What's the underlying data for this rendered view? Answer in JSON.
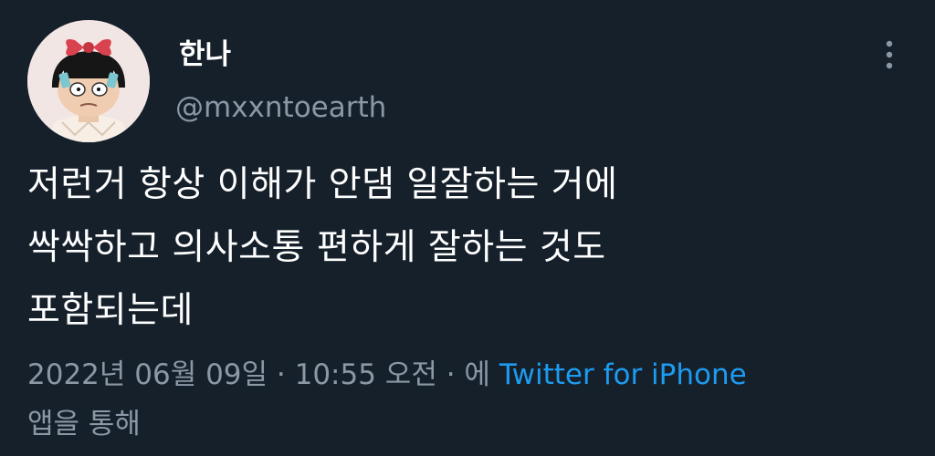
{
  "user": {
    "display_name": "한나",
    "handle": "@mxxntoearth"
  },
  "tweet": {
    "lines": [
      "저런거 항상 이해가 안댐 일잘하는 거에",
      "싹싹하고 의사소통 편하게 잘하는 것도",
      "포함되는데"
    ]
  },
  "meta": {
    "timestamp": "2022년 06월 09일 · 10:55 오전 ·",
    "via_prefix": "에",
    "source": "Twitter for iPhone",
    "via_suffix": "앱을 통해"
  },
  "icons": {
    "more": "more-vertical-icon"
  },
  "colors": {
    "background": "#15202b",
    "text": "#ffffff",
    "secondary_text": "#8b98a5",
    "link": "#1d9bf0"
  }
}
